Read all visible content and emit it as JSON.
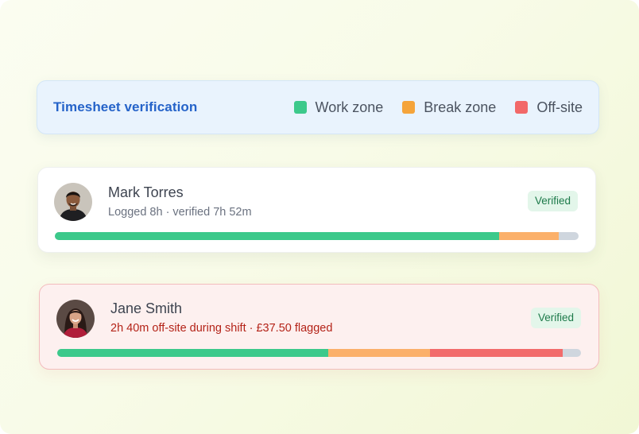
{
  "header": {
    "title": "Timesheet verification",
    "legend": [
      {
        "label": "Work zone",
        "color": "#3cc98b"
      },
      {
        "label": "Break zone",
        "color": "#f5a43a"
      },
      {
        "label": "Off-site",
        "color": "#f26868"
      }
    ]
  },
  "colors": {
    "work": "#3cc98b",
    "break": "#fbb06a",
    "offsite": "#f26b6b",
    "remainder": "#cfd6de",
    "badge_bg": "#e3f6ea",
    "badge_text": "#1d7a4a",
    "alert_text": "#b42318"
  },
  "employees": [
    {
      "name": "Mark Torres",
      "subtitle": "Logged 8h · verified 7h 52m",
      "status": "Verified",
      "avatar": "avatar-icon",
      "bar_fractions": {
        "work": 0.848,
        "break": 0.114,
        "offsite": 0.0
      }
    },
    {
      "name": "Jane Smith",
      "subtitle": "2h 40m off-site during shift · £37.50 flagged",
      "status": "Verified",
      "avatar": "avatar-icon",
      "bar_fractions": {
        "work": 0.517,
        "break": 0.194,
        "offsite": 0.254
      }
    }
  ]
}
